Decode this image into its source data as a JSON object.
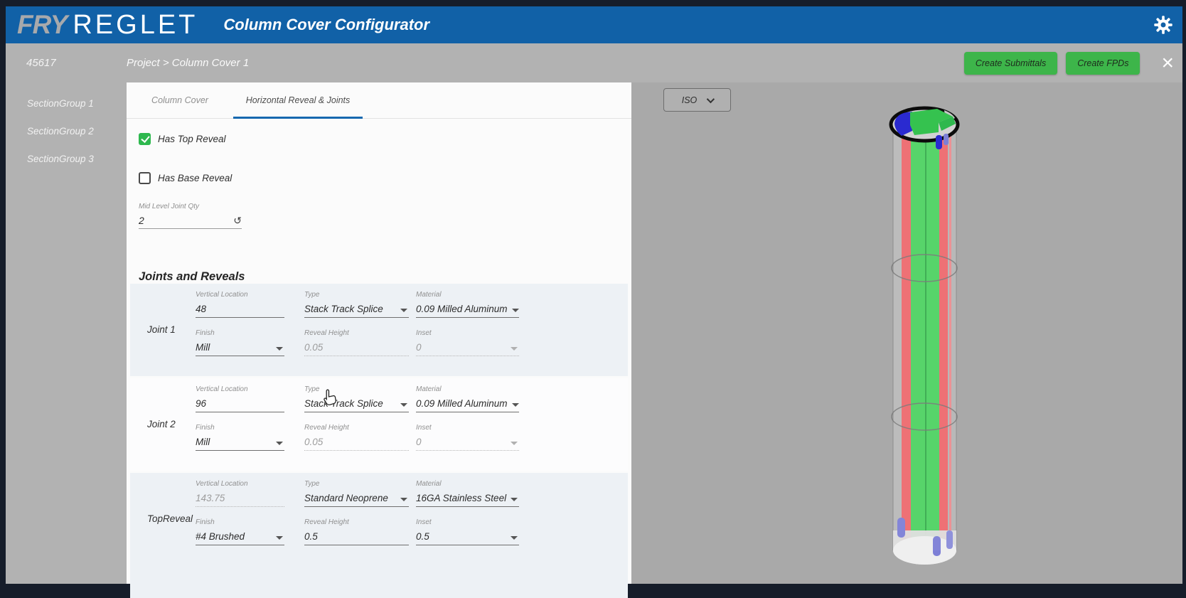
{
  "header": {
    "brand_fry": "FRY",
    "brand_reglet": "REGLET",
    "app_title": "Column Cover Configurator"
  },
  "subheader": {
    "project_number": "45617",
    "breadcrumb": "Project > Column Cover 1",
    "create_submittals_label": "Create Submittals",
    "create_fpds_label": "Create FPDs",
    "close_icon": "×"
  },
  "sidebar": {
    "items": [
      {
        "label": "SectionGroup 1"
      },
      {
        "label": "SectionGroup 2"
      },
      {
        "label": "SectionGroup 3"
      }
    ]
  },
  "form": {
    "tabs": [
      {
        "label": "Column Cover",
        "active": false
      },
      {
        "label": "Horizontal Reveal & Joints",
        "active": true
      }
    ],
    "checkboxes": [
      {
        "label": "Has Top Reveal",
        "checked": true
      },
      {
        "label": "Has Base Reveal",
        "checked": false
      }
    ],
    "mid_level_joint_qty": {
      "label": "Mid Level Joint Qty",
      "value": "2"
    },
    "section_title": "Joints and Reveals",
    "groups": [
      {
        "name": "Joint 1",
        "fields": [
          {
            "label": "Vertical Location",
            "value": "48",
            "control": "text",
            "disabled": false
          },
          {
            "label": "Type",
            "value": "Stack Track Splice",
            "control": "select",
            "disabled": false
          },
          {
            "label": "Material",
            "value": "0.09 Milled Aluminum",
            "control": "select",
            "disabled": false
          },
          {
            "label": "Finish",
            "value": "Mill",
            "control": "select",
            "disabled": false
          },
          {
            "label": "Reveal Height",
            "value": "0.05",
            "control": "text",
            "disabled": true
          },
          {
            "label": "Inset",
            "value": "0",
            "control": "select",
            "disabled": true
          }
        ]
      },
      {
        "name": "Joint 2",
        "fields": [
          {
            "label": "Vertical Location",
            "value": "96",
            "control": "text",
            "disabled": false
          },
          {
            "label": "Type",
            "value": "Stack Track Splice",
            "control": "select",
            "disabled": false
          },
          {
            "label": "Material",
            "value": "0.09 Milled Aluminum",
            "control": "select",
            "disabled": false
          },
          {
            "label": "Finish",
            "value": "Mill",
            "control": "select",
            "disabled": false
          },
          {
            "label": "Reveal Height",
            "value": "0.05",
            "control": "text",
            "disabled": true
          },
          {
            "label": "Inset",
            "value": "0",
            "control": "select",
            "disabled": true
          }
        ]
      },
      {
        "name": "TopReveal",
        "fields": [
          {
            "label": "Vertical Location",
            "value": "143.75",
            "control": "text",
            "disabled": true
          },
          {
            "label": "Type",
            "value": "Standard Neoprene",
            "control": "select",
            "disabled": false
          },
          {
            "label": "Material",
            "value": "16GA Stainless Steel",
            "control": "select",
            "disabled": false
          },
          {
            "label": "Finish",
            "value": "#4 Brushed",
            "control": "select",
            "disabled": false
          },
          {
            "label": "Reveal Height",
            "value": "0.5",
            "control": "text",
            "disabled": false
          },
          {
            "label": "Inset",
            "value": "0.5",
            "control": "select",
            "disabled": false
          }
        ]
      }
    ]
  },
  "viewport": {
    "view_selector": {
      "value": "ISO"
    },
    "model_colors": {
      "panel_green": "#4fd263",
      "reveal_red": "#ee6a6e",
      "accent_blue": "#2a2ad0",
      "accent_purple": "#7d7fd6"
    }
  },
  "theme": {
    "header_blue": "#1161a7",
    "button_green": "#3db54a",
    "checkbox_green": "#2eb84e",
    "tab_underline_blue": "#1668af",
    "group_row_shade": "#edf1f5"
  }
}
